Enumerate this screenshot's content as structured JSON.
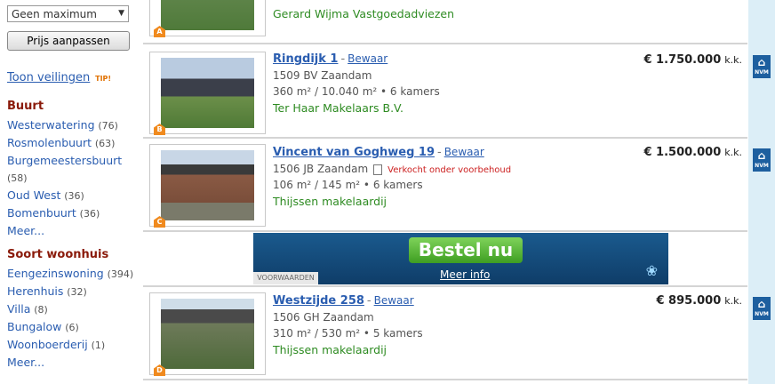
{
  "sidebar": {
    "max_select": "Geen maximum",
    "apply_button": "Prijs aanpassen",
    "auctions_link": "Toon veilingen",
    "tip": "TIP!",
    "buurt": {
      "heading": "Buurt",
      "items": [
        {
          "label": "Westerwatering",
          "count": "(76)"
        },
        {
          "label": "Rosmolenbuurt",
          "count": "(63)"
        },
        {
          "label": "Burgemeestersbuurt",
          "count": "(58)"
        },
        {
          "label": "Oud West",
          "count": "(36)"
        },
        {
          "label": "Bomenbuurt",
          "count": "(36)"
        }
      ],
      "more": "Meer..."
    },
    "soort": {
      "heading": "Soort woonhuis",
      "items": [
        {
          "label": "Eengezinswoning",
          "count": "(394)"
        },
        {
          "label": "Herenhuis",
          "count": "(32)"
        },
        {
          "label": "Villa",
          "count": "(8)"
        },
        {
          "label": "Bungalow",
          "count": "(6)"
        },
        {
          "label": "Woonboerderij",
          "count": "(1)"
        }
      ],
      "more": "Meer..."
    }
  },
  "listings": [
    {
      "badge": "A",
      "agent": "Gerard Wijma Vastgoedadviezen"
    },
    {
      "badge": "B",
      "title": "Ringdijk 1",
      "save": "Bewaar",
      "postal": "1509 BV Zaandam",
      "specs": "360 m² / 10.040 m² • 6 kamers",
      "agent": "Ter Haar Makelaars B.V.",
      "price": "€ 1.750.000",
      "suffix": "k.k.",
      "nvm": "NVM"
    },
    {
      "badge": "C",
      "title": "Vincent van Goghweg 19",
      "save": "Bewaar",
      "postal": "1506 JB Zaandam",
      "status": "Verkocht onder voorbehoud",
      "specs": "106 m² / 145 m² • 6 kamers",
      "agent": "Thijssen makelaardij",
      "price": "€ 1.500.000",
      "suffix": "k.k.",
      "nvm": "NVM"
    },
    {
      "badge": "D",
      "title": "Westzijde 258",
      "save": "Bewaar",
      "postal": "1506 GH Zaandam",
      "specs": "310 m² / 530 m² • 5 kamers",
      "agent": "Thijssen makelaardij",
      "price": "€ 895.000",
      "suffix": "k.k.",
      "nvm": "NVM"
    }
  ],
  "ad": {
    "cta": "Bestel nu",
    "more": "Meer info",
    "terms": "VOORWAARDEN"
  },
  "colors": {
    "agent": "#2e8b22",
    "link": "#2a5db0",
    "heading": "#8a1a0a",
    "badge": "#f08a1e"
  }
}
